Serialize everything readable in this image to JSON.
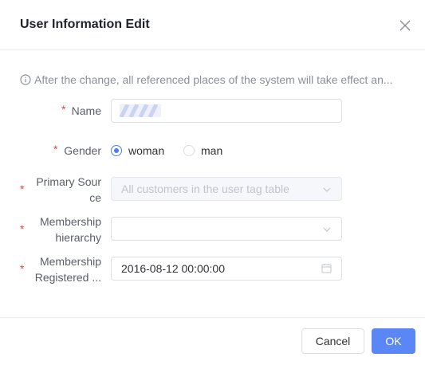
{
  "dialog": {
    "title": "User Information Edit"
  },
  "notice": {
    "text": "After the change, all referenced places of the system will take effect an..."
  },
  "form": {
    "name": {
      "label": "Name",
      "required_mark": "*",
      "value": ""
    },
    "gender": {
      "label": "Gender",
      "required_mark": "*",
      "options": [
        {
          "label": "woman",
          "checked": true
        },
        {
          "label": "man",
          "checked": false
        }
      ]
    },
    "primary_source": {
      "label_line1": "Primary Sour",
      "label_line2": "ce",
      "required_mark": "*",
      "value": "All customers in the user tag table",
      "disabled": true
    },
    "membership_hierarchy": {
      "label_line1": "Membership",
      "label_line2": "hierarchy",
      "required_mark": "*",
      "value": ""
    },
    "membership_registered": {
      "label_line1": "Membership",
      "label_line2": "Registered ...",
      "required_mark": "*",
      "value": "2016-08-12 00:00:00"
    }
  },
  "footer": {
    "cancel_label": "Cancel",
    "ok_label": "OK"
  },
  "colors": {
    "primary": "#5b86f6",
    "required": "#e0463a",
    "radio_checked": "#4a7cf6"
  }
}
